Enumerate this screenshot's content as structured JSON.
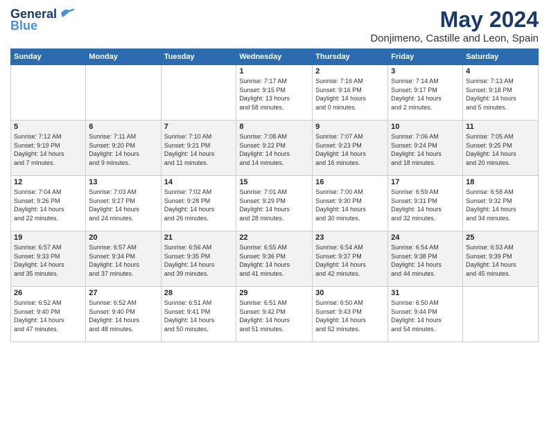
{
  "logo": {
    "line1": "General",
    "line2": "Blue"
  },
  "title": "May 2024",
  "location": "Donjimeno, Castille and Leon, Spain",
  "weekdays": [
    "Sunday",
    "Monday",
    "Tuesday",
    "Wednesday",
    "Thursday",
    "Friday",
    "Saturday"
  ],
  "weeks": [
    [
      {
        "day": "",
        "info": ""
      },
      {
        "day": "",
        "info": ""
      },
      {
        "day": "",
        "info": ""
      },
      {
        "day": "1",
        "info": "Sunrise: 7:17 AM\nSunset: 9:15 PM\nDaylight: 13 hours\nand 58 minutes."
      },
      {
        "day": "2",
        "info": "Sunrise: 7:16 AM\nSunset: 9:16 PM\nDaylight: 14 hours\nand 0 minutes."
      },
      {
        "day": "3",
        "info": "Sunrise: 7:14 AM\nSunset: 9:17 PM\nDaylight: 14 hours\nand 2 minutes."
      },
      {
        "day": "4",
        "info": "Sunrise: 7:13 AM\nSunset: 9:18 PM\nDaylight: 14 hours\nand 5 minutes."
      }
    ],
    [
      {
        "day": "5",
        "info": "Sunrise: 7:12 AM\nSunset: 9:19 PM\nDaylight: 14 hours\nand 7 minutes."
      },
      {
        "day": "6",
        "info": "Sunrise: 7:11 AM\nSunset: 9:20 PM\nDaylight: 14 hours\nand 9 minutes."
      },
      {
        "day": "7",
        "info": "Sunrise: 7:10 AM\nSunset: 9:21 PM\nDaylight: 14 hours\nand 11 minutes."
      },
      {
        "day": "8",
        "info": "Sunrise: 7:08 AM\nSunset: 9:22 PM\nDaylight: 14 hours\nand 14 minutes."
      },
      {
        "day": "9",
        "info": "Sunrise: 7:07 AM\nSunset: 9:23 PM\nDaylight: 14 hours\nand 16 minutes."
      },
      {
        "day": "10",
        "info": "Sunrise: 7:06 AM\nSunset: 9:24 PM\nDaylight: 14 hours\nand 18 minutes."
      },
      {
        "day": "11",
        "info": "Sunrise: 7:05 AM\nSunset: 9:25 PM\nDaylight: 14 hours\nand 20 minutes."
      }
    ],
    [
      {
        "day": "12",
        "info": "Sunrise: 7:04 AM\nSunset: 9:26 PM\nDaylight: 14 hours\nand 22 minutes."
      },
      {
        "day": "13",
        "info": "Sunrise: 7:03 AM\nSunset: 9:27 PM\nDaylight: 14 hours\nand 24 minutes."
      },
      {
        "day": "14",
        "info": "Sunrise: 7:02 AM\nSunset: 9:28 PM\nDaylight: 14 hours\nand 26 minutes."
      },
      {
        "day": "15",
        "info": "Sunrise: 7:01 AM\nSunset: 9:29 PM\nDaylight: 14 hours\nand 28 minutes."
      },
      {
        "day": "16",
        "info": "Sunrise: 7:00 AM\nSunset: 9:30 PM\nDaylight: 14 hours\nand 30 minutes."
      },
      {
        "day": "17",
        "info": "Sunrise: 6:59 AM\nSunset: 9:31 PM\nDaylight: 14 hours\nand 32 minutes."
      },
      {
        "day": "18",
        "info": "Sunrise: 6:58 AM\nSunset: 9:32 PM\nDaylight: 14 hours\nand 34 minutes."
      }
    ],
    [
      {
        "day": "19",
        "info": "Sunrise: 6:57 AM\nSunset: 9:33 PM\nDaylight: 14 hours\nand 35 minutes."
      },
      {
        "day": "20",
        "info": "Sunrise: 6:57 AM\nSunset: 9:34 PM\nDaylight: 14 hours\nand 37 minutes."
      },
      {
        "day": "21",
        "info": "Sunrise: 6:56 AM\nSunset: 9:35 PM\nDaylight: 14 hours\nand 39 minutes."
      },
      {
        "day": "22",
        "info": "Sunrise: 6:55 AM\nSunset: 9:36 PM\nDaylight: 14 hours\nand 41 minutes."
      },
      {
        "day": "23",
        "info": "Sunrise: 6:54 AM\nSunset: 9:37 PM\nDaylight: 14 hours\nand 42 minutes."
      },
      {
        "day": "24",
        "info": "Sunrise: 6:54 AM\nSunset: 9:38 PM\nDaylight: 14 hours\nand 44 minutes."
      },
      {
        "day": "25",
        "info": "Sunrise: 6:53 AM\nSunset: 9:39 PM\nDaylight: 14 hours\nand 45 minutes."
      }
    ],
    [
      {
        "day": "26",
        "info": "Sunrise: 6:52 AM\nSunset: 9:40 PM\nDaylight: 14 hours\nand 47 minutes."
      },
      {
        "day": "27",
        "info": "Sunrise: 6:52 AM\nSunset: 9:40 PM\nDaylight: 14 hours\nand 48 minutes."
      },
      {
        "day": "28",
        "info": "Sunrise: 6:51 AM\nSunset: 9:41 PM\nDaylight: 14 hours\nand 50 minutes."
      },
      {
        "day": "29",
        "info": "Sunrise: 6:51 AM\nSunset: 9:42 PM\nDaylight: 14 hours\nand 51 minutes."
      },
      {
        "day": "30",
        "info": "Sunrise: 6:50 AM\nSunset: 9:43 PM\nDaylight: 14 hours\nand 52 minutes."
      },
      {
        "day": "31",
        "info": "Sunrise: 6:50 AM\nSunset: 9:44 PM\nDaylight: 14 hours\nand 54 minutes."
      },
      {
        "day": "",
        "info": ""
      }
    ]
  ]
}
